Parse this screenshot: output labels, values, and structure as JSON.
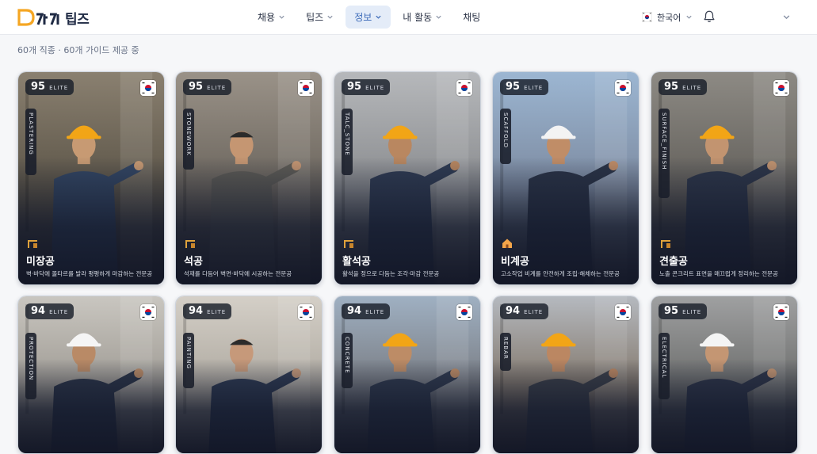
{
  "brand": {
    "logo_text": "팁즈"
  },
  "nav": [
    {
      "label": "채용",
      "has_dropdown": true,
      "active": false
    },
    {
      "label": "팁즈",
      "has_dropdown": true,
      "active": false
    },
    {
      "label": "정보",
      "has_dropdown": true,
      "active": true
    },
    {
      "label": "내 활동",
      "has_dropdown": true,
      "active": false
    },
    {
      "label": "채팅",
      "has_dropdown": false,
      "active": false
    }
  ],
  "language": {
    "label": "한국어"
  },
  "subtitle": "60개 직종 · 60개 가이드 제공 중",
  "colors": {
    "accent": "#3a69b8",
    "brand_orange": "#f5a623",
    "brand_navy": "#1f2a44"
  },
  "cards": [
    {
      "score": "95",
      "tier": "ELITE",
      "tag": "PLASTERING",
      "name": "미장공",
      "desc": "벽·바닥에 몰타르를 발라 평평하게 마감하는 전문공",
      "icon": "construction-icon",
      "theme": "plaster"
    },
    {
      "score": "95",
      "tier": "ELITE",
      "tag": "STONEWORK",
      "name": "석공",
      "desc": "석재를 다듬어 벽면·바닥에 시공하는 전문공",
      "icon": "construction-icon",
      "theme": "stone"
    },
    {
      "score": "95",
      "tier": "ELITE",
      "tag": "TALC_STONE",
      "name": "활석공",
      "desc": "활석을 정으로 다듬는 조각·마감 전문공",
      "icon": "construction-icon",
      "theme": "quarry"
    },
    {
      "score": "95",
      "tier": "ELITE",
      "tag": "SCAFFOLD",
      "name": "비계공",
      "desc": "고소작업 비계를 안전하게 조립·해체하는 전문공",
      "icon": "house-icon",
      "theme": "scaffold"
    },
    {
      "score": "95",
      "tier": "ELITE",
      "tag": "SURFACE_FINISH",
      "name": "견출공",
      "desc": "노출 콘크리트 표면을 매끄럽게 정리하는 전문공",
      "icon": "construction-icon",
      "theme": "surface"
    },
    {
      "score": "94",
      "tier": "ELITE",
      "tag": "PROTECTION",
      "name": "",
      "desc": "",
      "icon": "",
      "theme": "protect"
    },
    {
      "score": "94",
      "tier": "ELITE",
      "tag": "PAINTING",
      "name": "",
      "desc": "",
      "icon": "",
      "theme": "paint"
    },
    {
      "score": "94",
      "tier": "ELITE",
      "tag": "CONCRETE",
      "name": "",
      "desc": "",
      "icon": "",
      "theme": "concrete"
    },
    {
      "score": "94",
      "tier": "ELITE",
      "tag": "REBAR",
      "name": "",
      "desc": "",
      "icon": "",
      "theme": "rebar"
    },
    {
      "score": "95",
      "tier": "ELITE",
      "tag": "ELECTRICAL",
      "name": "",
      "desc": "",
      "icon": "",
      "theme": "electric"
    }
  ]
}
